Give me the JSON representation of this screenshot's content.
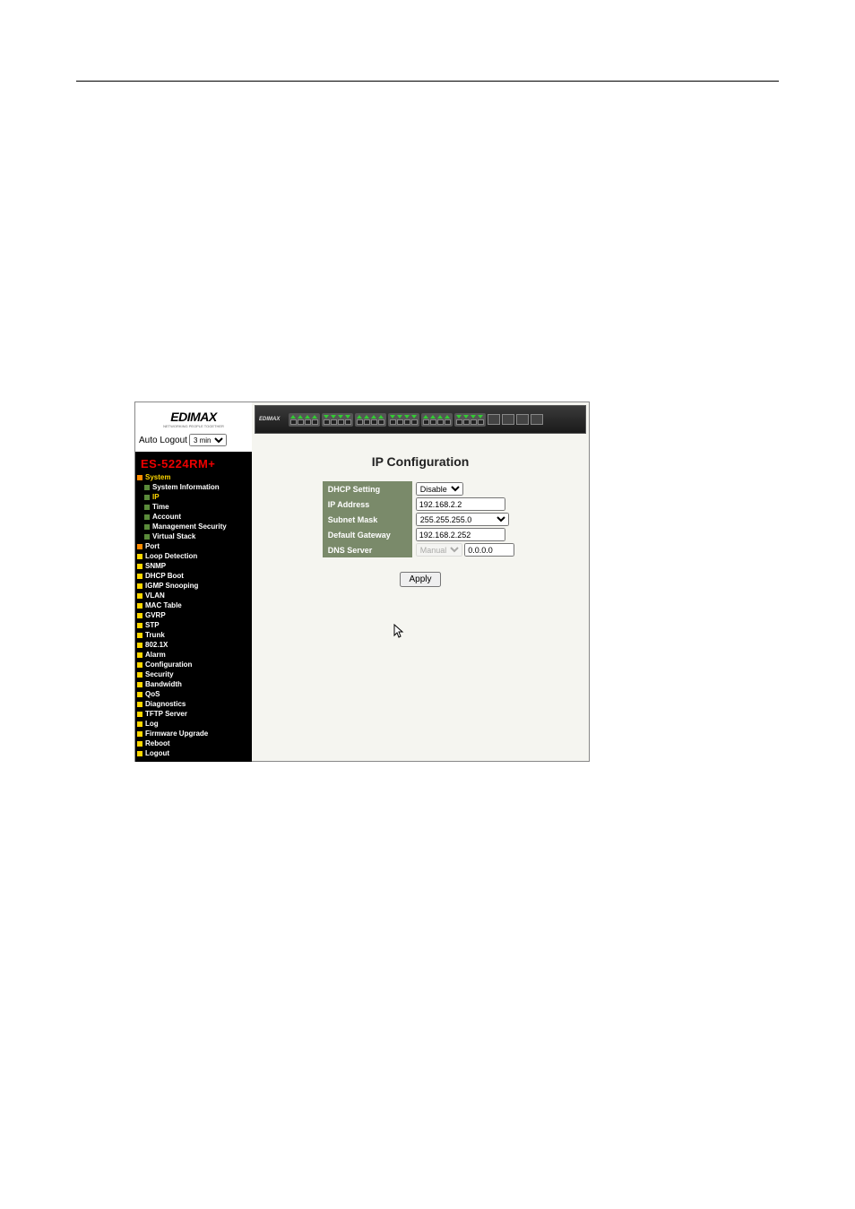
{
  "logo": "EDIMAX",
  "logo_sub": "NETWORKING PEOPLE TOGETHER",
  "auto_logout_label": "Auto Logout",
  "auto_logout_value": "3 min",
  "device_model": "ES-5224RM+",
  "nav": {
    "sections": [
      {
        "label": "System",
        "style": "expanded",
        "color": "orange"
      },
      {
        "label": "System Information",
        "style": "sub",
        "color": "green"
      },
      {
        "label": "IP",
        "style": "sub active",
        "color": "green"
      },
      {
        "label": "Time",
        "style": "sub",
        "color": "green"
      },
      {
        "label": "Account",
        "style": "sub",
        "color": "green"
      },
      {
        "label": "Management Security",
        "style": "sub",
        "color": "green"
      },
      {
        "label": "Virtual Stack",
        "style": "sub",
        "color": "green"
      },
      {
        "label": "Port",
        "style": "",
        "color": "orange"
      },
      {
        "label": "Loop Detection",
        "style": "",
        "color": "yellow"
      },
      {
        "label": "SNMP",
        "style": "",
        "color": "yellow"
      },
      {
        "label": "DHCP Boot",
        "style": "",
        "color": "yellow"
      },
      {
        "label": "IGMP Snooping",
        "style": "",
        "color": "yellow"
      },
      {
        "label": "VLAN",
        "style": "",
        "color": "yellow"
      },
      {
        "label": "MAC Table",
        "style": "",
        "color": "yellow"
      },
      {
        "label": "GVRP",
        "style": "",
        "color": "yellow"
      },
      {
        "label": "STP",
        "style": "",
        "color": "yellow"
      },
      {
        "label": "Trunk",
        "style": "",
        "color": "yellow"
      },
      {
        "label": "802.1X",
        "style": "",
        "color": "yellow"
      },
      {
        "label": "Alarm",
        "style": "",
        "color": "yellow"
      },
      {
        "label": "Configuration",
        "style": "",
        "color": "yellow"
      },
      {
        "label": "Security",
        "style": "",
        "color": "yellow"
      },
      {
        "label": "Bandwidth",
        "style": "",
        "color": "yellow"
      },
      {
        "label": "QoS",
        "style": "",
        "color": "yellow"
      },
      {
        "label": "Diagnostics",
        "style": "",
        "color": "yellow"
      },
      {
        "label": "TFTP Server",
        "style": "",
        "color": "yellow"
      },
      {
        "label": "Log",
        "style": "",
        "color": "yellow"
      },
      {
        "label": "Firmware Upgrade",
        "style": "",
        "color": "yellow"
      },
      {
        "label": "Reboot",
        "style": "",
        "color": "yellow"
      },
      {
        "label": "Logout",
        "style": "",
        "color": "yellow"
      }
    ]
  },
  "page_title": "IP Configuration",
  "form": {
    "dhcp_label": "DHCP Setting",
    "dhcp_value": "Disable",
    "ip_label": "IP Address",
    "ip_value": "192.168.2.2",
    "mask_label": "Subnet Mask",
    "mask_value": "255.255.255.0",
    "gw_label": "Default Gateway",
    "gw_value": "192.168.2.252",
    "dns_label": "DNS Server",
    "dns_mode": "Manual",
    "dns_value": "0.0.0.0"
  },
  "apply_label": "Apply"
}
